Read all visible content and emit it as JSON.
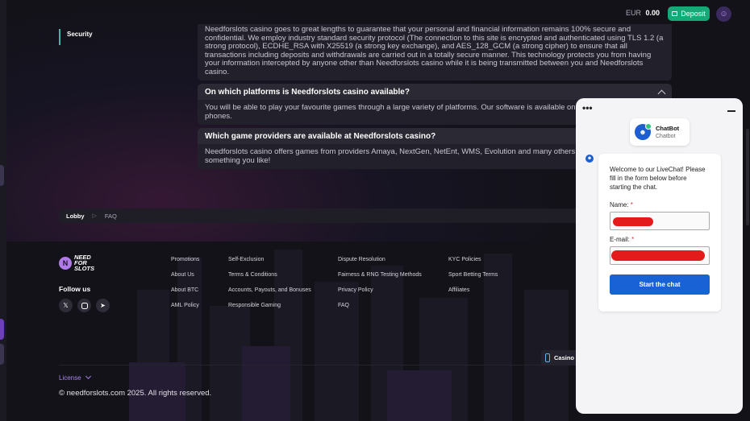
{
  "topbar": {
    "currency": "EUR",
    "balance": "0.00",
    "deposit_label": "Deposit"
  },
  "faq": {
    "side_label": "Security",
    "items": [
      {
        "question": "",
        "answer": "Needforslots casino goes to great lengths to guarantee that your personal and financial information remains 100% secure and confidential. We employ industry standard security protocol (The connection to this site is encrypted and authenticated using TLS 1.2 (a strong protocol), ECDHE_RSA with X25519 (a strong key exchange), and AES_128_GCM (a strong cipher) to ensure that all transactions including deposits and withdrawals are carried out in a totally secure manner. This technology protects you from having your information intercepted by anyone other than Needforslots casino while it is being transmitted between you and Needforslots casino."
      },
      {
        "question": "On which platforms is Needforslots casino available?",
        "answer": "You will be able to play your favourite games through a large variety of platforms. Our software is available on PC, tablets and smart phones."
      },
      {
        "question": "Which game providers are available at Needforslots casino?",
        "answer": "Needforslots casino offers games from providers Amaya, NextGen, NetEnt, WMS, Evolution and many others, so you will always find something you like!"
      }
    ]
  },
  "breadcrumb": {
    "home": "Lobby",
    "separator": "▷",
    "current": "FAQ"
  },
  "footer": {
    "logo_text": "NEED FOR SLOTS",
    "follow_label": "Follow us",
    "socials": [
      "x-icon",
      "instagram-icon",
      "telegram-icon"
    ],
    "columns": [
      [
        "Promotions",
        "About Us",
        "About BTC",
        "AML Policy"
      ],
      [
        "Self-Exclusion",
        "Terms & Conditions",
        "Accounts, Payouts, and Bonuses",
        "Responsible Gaming"
      ],
      [
        "Dispute Resolution",
        "Fairness & RNG Testing Methods",
        "Privacy Policy",
        "FAQ"
      ],
      [
        "KYC Policies",
        "Sport Betting Terms",
        "Affiliates"
      ]
    ],
    "casino_badge": "Casino",
    "license_label": "License",
    "copyright": "© needforslots.com 2025. All rights reserved."
  },
  "chat": {
    "dots": "•••",
    "bot_name": "ChatBot",
    "bot_sub": "Chatbot",
    "welcome": "Welcome to our LiveChat! Please fill in the form below before starting the chat.",
    "name_label": "Name:",
    "email_label": "E-mail:",
    "required_mark": "*",
    "start_label": "Start the chat"
  }
}
